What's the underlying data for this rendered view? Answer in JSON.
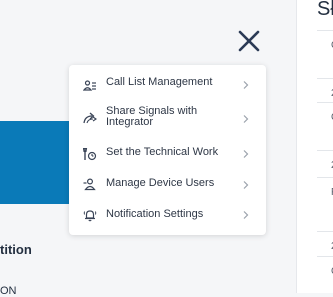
{
  "background_panel": {
    "partition_label": "tition",
    "status_label": "ON"
  },
  "right_panel": {
    "title": "Sł",
    "rows": [
      "C",
      "2",
      "C",
      "2",
      "F",
      "2",
      "C"
    ]
  },
  "close_button": {
    "icon": "close-icon"
  },
  "menu": {
    "items": [
      {
        "label": "Call List Management",
        "icon": "call-list-icon"
      },
      {
        "label": "Share Signals with Integrator",
        "icon": "share-signals-icon"
      },
      {
        "label": "Set the Technical Work",
        "icon": "technical-work-icon"
      },
      {
        "label": "Manage Device Users",
        "icon": "device-users-icon"
      },
      {
        "label": "Notification Settings",
        "icon": "notification-bell-icon"
      }
    ]
  },
  "colors": {
    "accent_blue": "#0a7ab8",
    "text_dark": "#2b3443",
    "chevron": "#9aa1ab",
    "background": "#f5f6f8"
  }
}
